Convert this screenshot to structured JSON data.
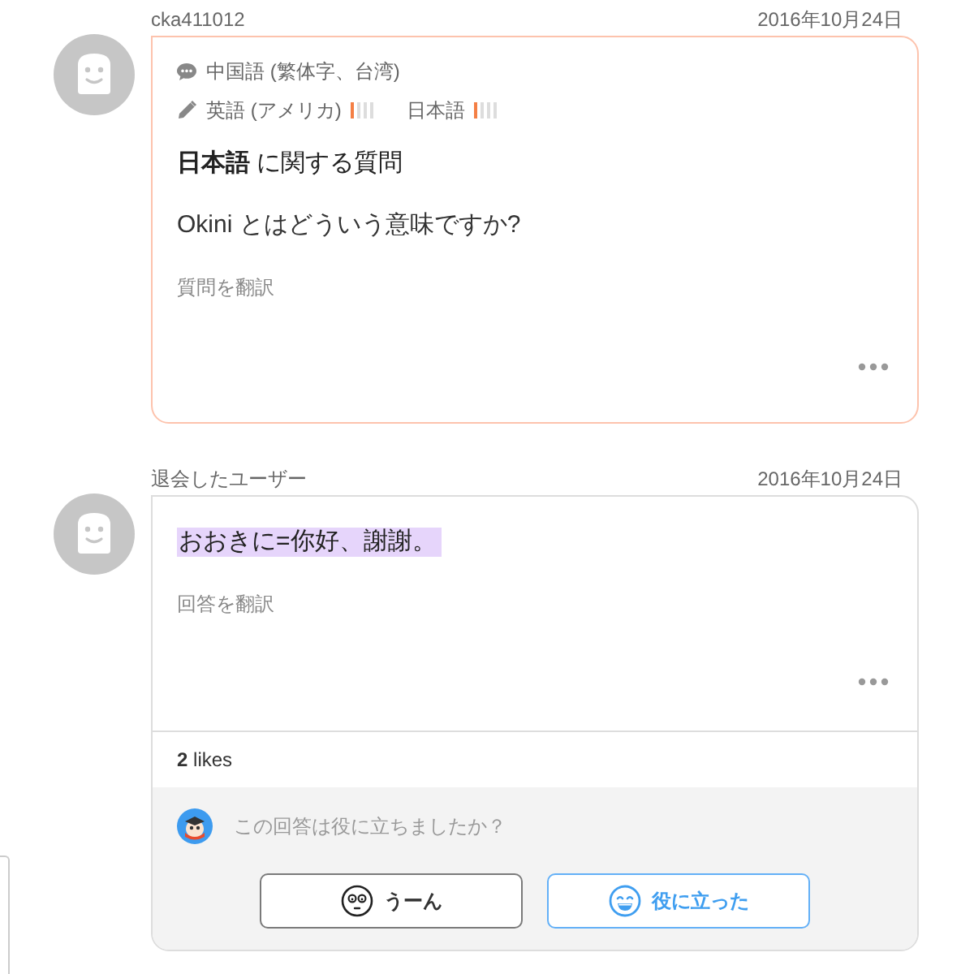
{
  "posts": [
    {
      "kind": "question",
      "user": "cka411012",
      "date": "2016年10月24日",
      "native_languages": [
        {
          "name": "中国語 (繁体字、台湾)"
        }
      ],
      "learning_languages": [
        {
          "name": "英語 (アメリカ)",
          "level": 0.25
        },
        {
          "name": "日本語",
          "level": 0.25
        }
      ],
      "title": "**日本語** に関する質問",
      "body": "Okini とはどういう意味ですか?",
      "highlighted": false,
      "translate_link": "質問を翻訳"
    },
    {
      "kind": "answer",
      "user": "退会したユーザー",
      "date": "2016年10月24日",
      "body": "おおきに=你好、謝謝。",
      "highlighted": true,
      "translate_link": "回答を翻訳",
      "likes": "**2** likes",
      "feedback_prompt": "この回答は役に立ちましたか？",
      "feedback_buttons": [
        {
          "kind": "meh",
          "label": "うーん"
        },
        {
          "kind": "helpful",
          "label": "役に立った"
        }
      ]
    }
  ]
}
